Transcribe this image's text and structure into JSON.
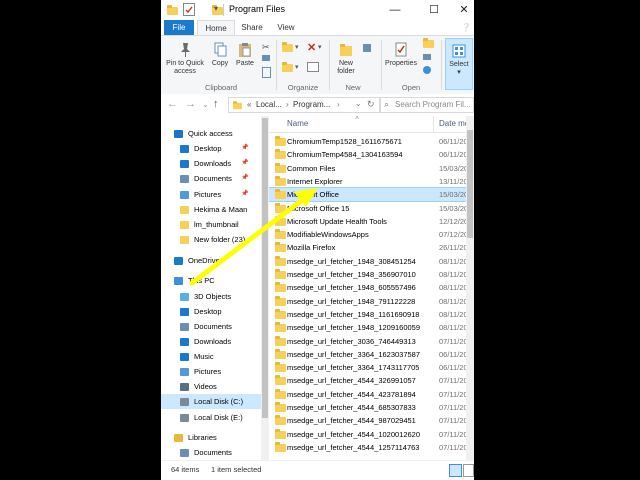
{
  "window": {
    "title": "Program Files"
  },
  "ribbon": {
    "tabs": [
      "File",
      "Home",
      "Share",
      "View"
    ],
    "pin_label_1": "Pin to Quick",
    "pin_label_2": "access",
    "copy_label": "Copy",
    "paste_label": "Paste",
    "new_folder_label_1": "New",
    "new_folder_label_2": "folder",
    "properties_label": "Properties",
    "select_label": "Select",
    "groups": [
      "Clipboard",
      "Organize",
      "New",
      "Open"
    ]
  },
  "address": {
    "path": [
      "«",
      "Local...",
      "Program...",
      "›"
    ],
    "search_placeholder": "Search Program Fil..."
  },
  "nav": {
    "items": [
      {
        "label": "Quick access",
        "icon": "star-icon",
        "color": "#1a73c9",
        "indent": 0
      },
      {
        "label": "Desktop",
        "icon": "desktop-icon",
        "color": "#1979ca",
        "indent": 1,
        "pinned": true
      },
      {
        "label": "Downloads",
        "icon": "download-icon",
        "color": "#1979ca",
        "indent": 1,
        "pinned": true
      },
      {
        "label": "Documents",
        "icon": "documents-icon",
        "color": "#6b8fb3",
        "indent": 1,
        "pinned": true
      },
      {
        "label": "Pictures",
        "icon": "pictures-icon",
        "color": "#4f9ad8",
        "indent": 1,
        "pinned": true
      },
      {
        "label": "Hekima & Maan",
        "icon": "folder-icon",
        "color": "#f7cf59",
        "indent": 1
      },
      {
        "label": "lm_thumbnail",
        "icon": "folder-icon",
        "color": "#f7cf59",
        "indent": 1
      },
      {
        "label": "New folder (23)",
        "icon": "folder-icon",
        "color": "#f7cf59",
        "indent": 1
      },
      {
        "label": "OneDrive",
        "icon": "cloud-icon",
        "color": "#1979ca",
        "indent": 0
      },
      {
        "label": "This PC",
        "icon": "computer-icon",
        "color": "#3c8fd8",
        "indent": 0
      },
      {
        "label": "3D Objects",
        "icon": "cube-icon",
        "color": "#57b0e8",
        "indent": 1
      },
      {
        "label": "Desktop",
        "icon": "desktop-icon",
        "color": "#1979ca",
        "indent": 1
      },
      {
        "label": "Documents",
        "icon": "documents-icon",
        "color": "#6b8fb3",
        "indent": 1
      },
      {
        "label": "Downloads",
        "icon": "download-icon",
        "color": "#1979ca",
        "indent": 1
      },
      {
        "label": "Music",
        "icon": "music-icon",
        "color": "#1979ca",
        "indent": 1
      },
      {
        "label": "Pictures",
        "icon": "pictures-icon",
        "color": "#4f9ad8",
        "indent": 1
      },
      {
        "label": "Videos",
        "icon": "video-icon",
        "color": "#5a6e82",
        "indent": 1
      },
      {
        "label": "Local Disk (C:)",
        "icon": "drive-icon",
        "color": "#7a8a99",
        "indent": 1,
        "selected": true
      },
      {
        "label": "Local Disk (E:)",
        "icon": "drive-icon",
        "color": "#7a8a99",
        "indent": 1
      },
      {
        "label": "Libraries",
        "icon": "library-icon",
        "color": "#e9b640",
        "indent": 0
      },
      {
        "label": "Documents",
        "icon": "documents-icon",
        "color": "#6b8fb3",
        "indent": 1
      }
    ]
  },
  "files": {
    "col_name": "Name",
    "col_date": "Date mo",
    "rows": [
      {
        "name": "ChromiumTemp1528_1611675671",
        "date": "06/11/20"
      },
      {
        "name": "ChromiumTemp4584_1304163594",
        "date": "06/11/20"
      },
      {
        "name": "Common Files",
        "date": "15/03/20"
      },
      {
        "name": "Internet Explorer",
        "date": "13/11/20"
      },
      {
        "name": "Microsoft Office",
        "date": "15/03/20",
        "selected": true
      },
      {
        "name": "Microsoft Office 15",
        "date": "15/03/20"
      },
      {
        "name": "Microsoft Update Health Tools",
        "date": "12/12/20"
      },
      {
        "name": "ModifiableWindowsApps",
        "date": "07/12/20"
      },
      {
        "name": "Mozilla Firefox",
        "date": "26/11/20"
      },
      {
        "name": "msedge_url_fetcher_1948_308451254",
        "date": "08/11/20"
      },
      {
        "name": "msedge_url_fetcher_1948_356907010",
        "date": "08/11/20"
      },
      {
        "name": "msedge_url_fetcher_1948_605557496",
        "date": "08/11/20"
      },
      {
        "name": "msedge_url_fetcher_1948_791122228",
        "date": "08/11/20"
      },
      {
        "name": "msedge_url_fetcher_1948_1161690918",
        "date": "08/11/20"
      },
      {
        "name": "msedge_url_fetcher_1948_1209160059",
        "date": "08/11/20"
      },
      {
        "name": "msedge_url_fetcher_3036_746449313",
        "date": "07/11/20"
      },
      {
        "name": "msedge_url_fetcher_3364_1623037587",
        "date": "06/11/20"
      },
      {
        "name": "msedge_url_fetcher_3364_1743117705",
        "date": "06/11/20"
      },
      {
        "name": "msedge_url_fetcher_4544_326991057",
        "date": "07/11/20"
      },
      {
        "name": "msedge_url_fetcher_4544_423781894",
        "date": "07/11/20"
      },
      {
        "name": "msedge_url_fetcher_4544_685307833",
        "date": "07/11/20"
      },
      {
        "name": "msedge_url_fetcher_4544_987029451",
        "date": "07/11/20"
      },
      {
        "name": "msedge_url_fetcher_4544_1020012620",
        "date": "07/11/20"
      },
      {
        "name": "msedge_url_fetcher_4544_1257114763",
        "date": "07/11/20"
      }
    ]
  },
  "status": {
    "count": "64 items",
    "selection": "1 item selected"
  },
  "colors": {
    "accent": "#1979ca",
    "selection": "#cce8ff",
    "arrow": "#ffff00",
    "folder": "#f7cf59"
  }
}
